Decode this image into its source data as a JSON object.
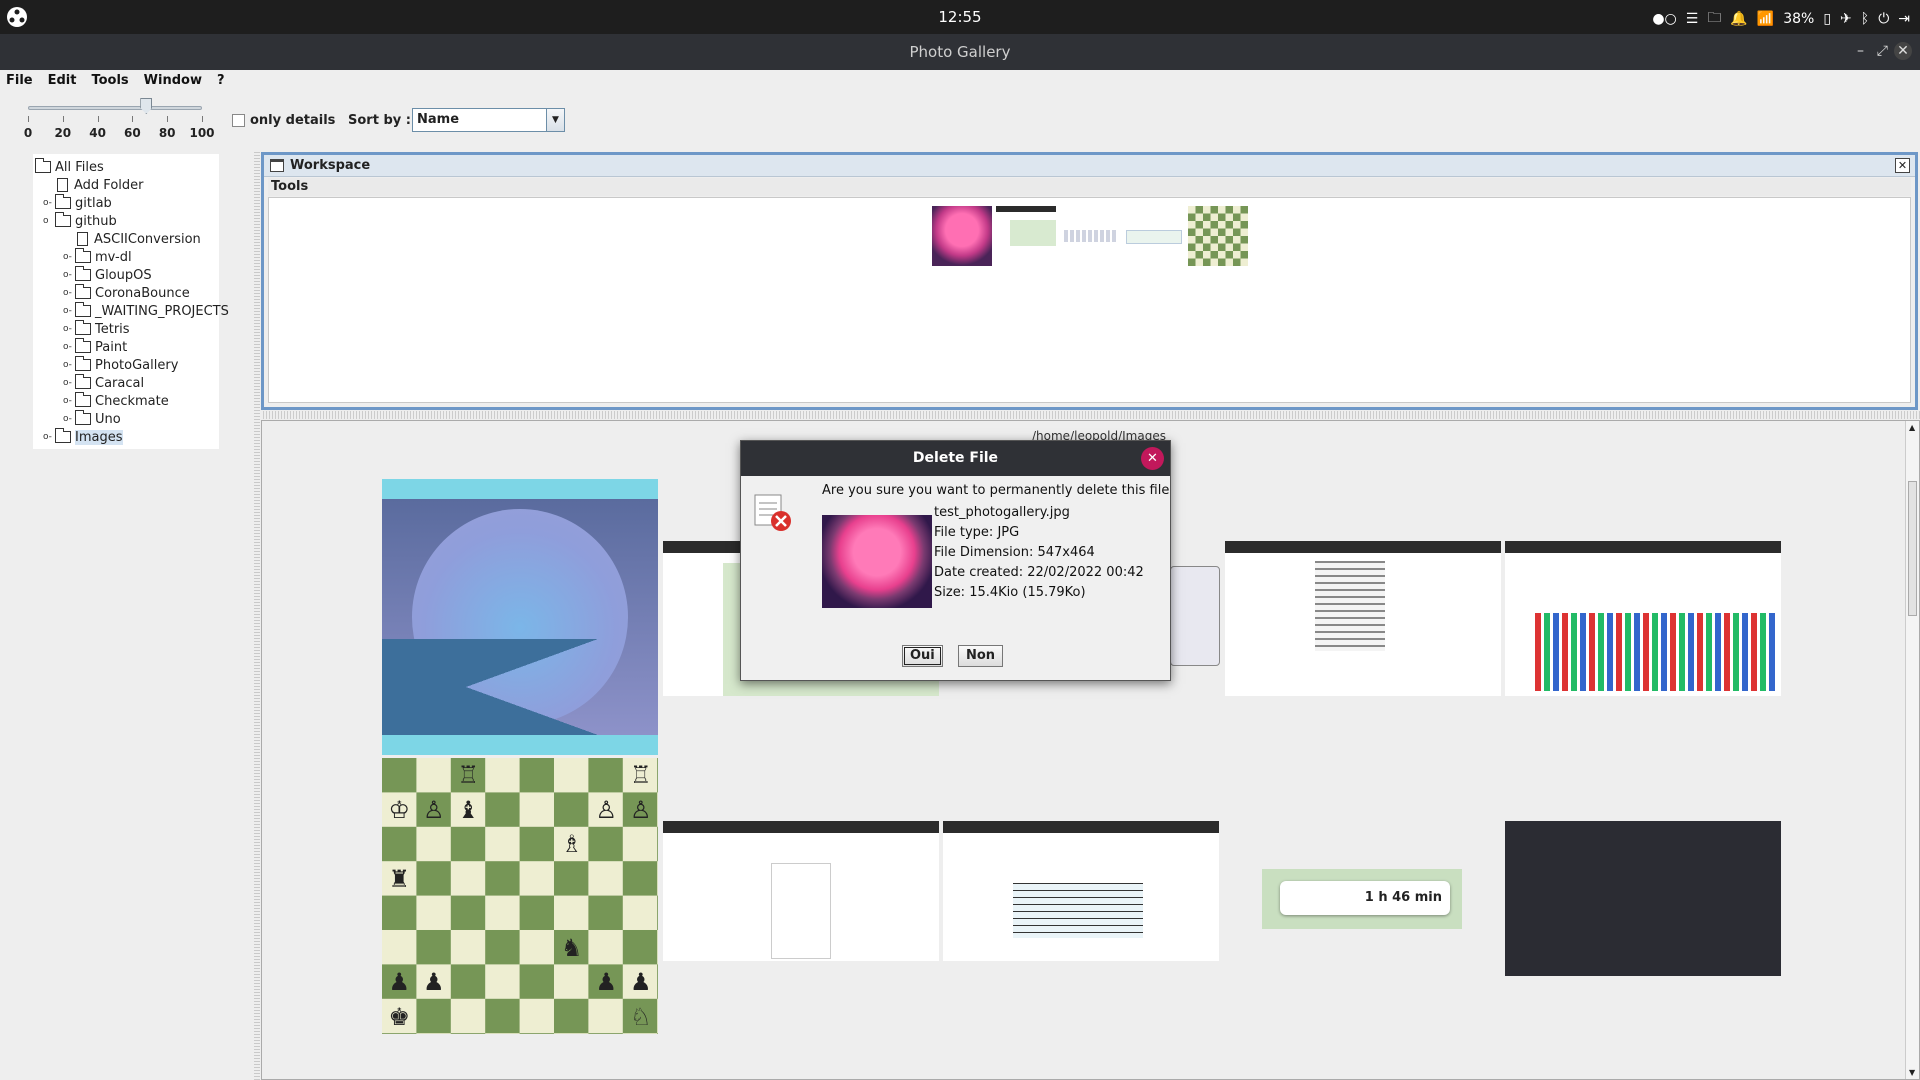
{
  "topbar": {
    "clock": "12:55",
    "battery": "38%"
  },
  "window": {
    "title": "Photo Gallery"
  },
  "menu": [
    "File",
    "Edit",
    "Tools",
    "Window",
    "?"
  ],
  "toolbar": {
    "zoom_ticks": [
      "0",
      "20",
      "40",
      "60",
      "80",
      "100"
    ],
    "zoom_value": 0.68,
    "only_details_label": "only details",
    "only_details_checked": false,
    "sort_label": "Sort by :",
    "sort_value": "Name"
  },
  "tree": {
    "items": [
      {
        "label": "All Files",
        "type": "folder",
        "level": 0,
        "handle": ""
      },
      {
        "label": "Add Folder",
        "type": "file",
        "level": 1,
        "handle": ""
      },
      {
        "label": "gitlab",
        "type": "folder",
        "level": 1,
        "handle": "o-"
      },
      {
        "label": "github",
        "type": "folder",
        "level": 1,
        "handle": "o"
      },
      {
        "label": "ASCIIConversion",
        "type": "file",
        "level": 2,
        "handle": ""
      },
      {
        "label": "mv-dl",
        "type": "folder",
        "level": 2,
        "handle": "o-"
      },
      {
        "label": "GloupOS",
        "type": "folder",
        "level": 2,
        "handle": "o-"
      },
      {
        "label": "CoronaBounce",
        "type": "folder",
        "level": 2,
        "handle": "o-"
      },
      {
        "label": "_WAITING_PROJECTS",
        "type": "folder",
        "level": 2,
        "handle": "o-"
      },
      {
        "label": "Tetris",
        "type": "folder",
        "level": 2,
        "handle": "o-"
      },
      {
        "label": "Paint",
        "type": "folder",
        "level": 2,
        "handle": "o-"
      },
      {
        "label": "PhotoGallery",
        "type": "folder",
        "level": 2,
        "handle": "o-"
      },
      {
        "label": "Caracal",
        "type": "folder",
        "level": 2,
        "handle": "o-"
      },
      {
        "label": "Checkmate",
        "type": "folder",
        "level": 2,
        "handle": "o-"
      },
      {
        "label": "Uno",
        "type": "folder",
        "level": 2,
        "handle": "o-"
      },
      {
        "label": "Images",
        "type": "folder",
        "level": 1,
        "handle": "o-",
        "selected": true
      }
    ]
  },
  "workspace": {
    "title": "Workspace",
    "tools_label": "Tools"
  },
  "gallery": {
    "path": "/home/leopold/Images",
    "map_eta": "1 h 46 min"
  },
  "dialog": {
    "title": "Delete File",
    "message": "Are you sure you want to permanently delete this file",
    "filename": "test_photogallery.jpg",
    "file_type": "File type: JPG",
    "dimension": "File Dimension: 547x464",
    "created": "Date created: 22/02/2022 00:42",
    "size": "Size: 15.4Kio (15.79Ko)",
    "yes": "Oui",
    "no": "Non"
  },
  "chess": {
    "rows": [
      [
        "",
        "",
        "♖",
        "",
        "",
        "",
        "",
        "♖"
      ],
      [
        "♔",
        "♙",
        "♝",
        "",
        "",
        "",
        "♙",
        "♙"
      ],
      [
        "",
        "",
        "",
        "",
        "",
        "♗",
        "",
        ""
      ],
      [
        "♜",
        "",
        "",
        "",
        "",
        "",
        "",
        ""
      ],
      [
        "",
        "",
        "",
        "",
        "",
        "",
        "",
        ""
      ],
      [
        "",
        "",
        "",
        "",
        "",
        "♞",
        "",
        ""
      ],
      [
        "♟",
        "♟",
        "",
        "",
        "",
        "",
        "♟",
        "♟"
      ],
      [
        "♚",
        "",
        "",
        "",
        "",
        "",
        "",
        "♘"
      ]
    ]
  }
}
